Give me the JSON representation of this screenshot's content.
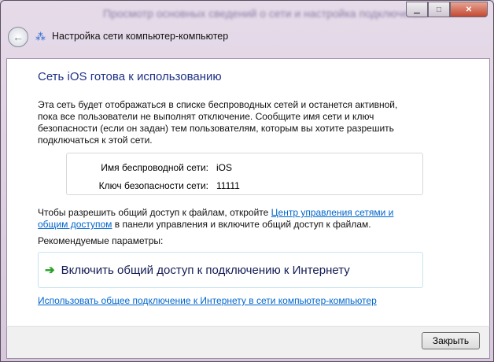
{
  "window": {
    "bg_title": "Просмотр основных сведений о сети и настройка подключений",
    "title": "Настройка сети компьютер-компьютер"
  },
  "heading": "Сеть iOS готова к использованию",
  "description": "Эта сеть будет отображаться в списке беспроводных сетей и останется активной, пока все пользователи не выполнят отключение. Сообщите имя сети и ключ безопасности (если он задан) тем пользователям, которым вы хотите разрешить подключаться к этой сети.",
  "info": {
    "ssid_label": "Имя беспроводной сети:",
    "ssid": "iOS",
    "key_label": "Ключ безопасности сети:",
    "key": "11111"
  },
  "share": {
    "before": "Чтобы разрешить общий доступ к файлам, откройте ",
    "link": "Центр управления сетями и общим доступом",
    "after": " в панели управления и включите общий доступ к файлам."
  },
  "recommended": "Рекомендуемые параметры:",
  "command": "Включить общий доступ к подключению к Интернету",
  "ics_link": "Использовать общее подключение к Интернету в сети компьютер-компьютер",
  "close_button": "Закрыть"
}
